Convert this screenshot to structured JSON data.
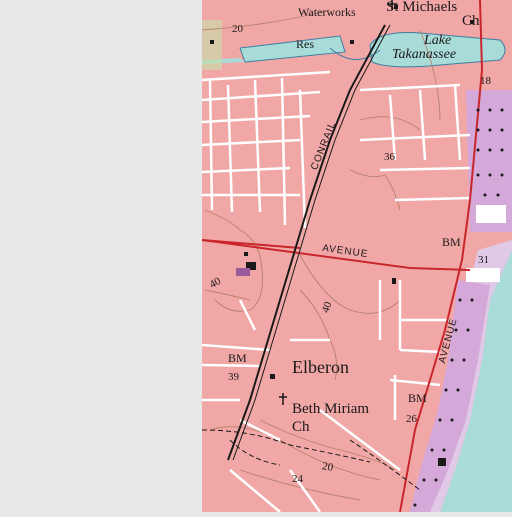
{
  "map": {
    "style": "USGS topographic quadrangle",
    "colors": {
      "urban": "#f2a7a7",
      "water": "#a9dcd9",
      "purple_revision": "#d4a8d8",
      "roads_major": "#c8262a",
      "contours": "#b4826a",
      "no_data": "#e8e8e8"
    }
  },
  "labels": {
    "waterworks": "Waterworks",
    "st_michaels": "St Michaels",
    "ch_north": "Ch",
    "contour_20_north": "20",
    "res": "Res",
    "lake": "Lake",
    "takanassee": "Takanassee",
    "bm_18": "18",
    "conrail": "CONRAIL",
    "contour_36": "36",
    "bm_north": "BM",
    "elev_31": "31",
    "avenue_ew": "AVENUE",
    "contour_40_west": "40",
    "contour_40_mid": "40",
    "avenue_ns": "AVENUE",
    "bm_elberon": "BM",
    "elberon": "Elberon",
    "elev_39": "39",
    "bm_south": "BM",
    "beth_miriam": "Beth Miriam",
    "ch_south": "Ch",
    "elev_26": "26",
    "contour_20_south": "20",
    "elev_24": "24"
  }
}
